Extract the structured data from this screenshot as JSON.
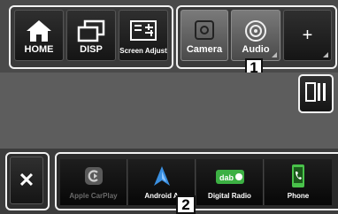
{
  "top_left": {
    "home_label": "HOME",
    "disp_label": "DISP",
    "screen_adjust_label": "Screen Adjust"
  },
  "top_right": {
    "camera_label": "Camera",
    "audio_label": "Audio",
    "add_label": "+"
  },
  "callouts": {
    "one": "1",
    "two": "2"
  },
  "close_label": "✕",
  "apps": [
    {
      "label": "Apple CarPlay",
      "icon": "carplay-icon"
    },
    {
      "label": "Android A",
      "icon": "android-auto-icon"
    },
    {
      "label": "Digital Radio",
      "icon": "dab-radio-icon"
    },
    {
      "label": "Phone",
      "icon": "phone-icon"
    }
  ],
  "colors": {
    "accent_blue": "#3a8fe0",
    "dab_green": "#3cb043",
    "phone_green": "#49c24a"
  }
}
